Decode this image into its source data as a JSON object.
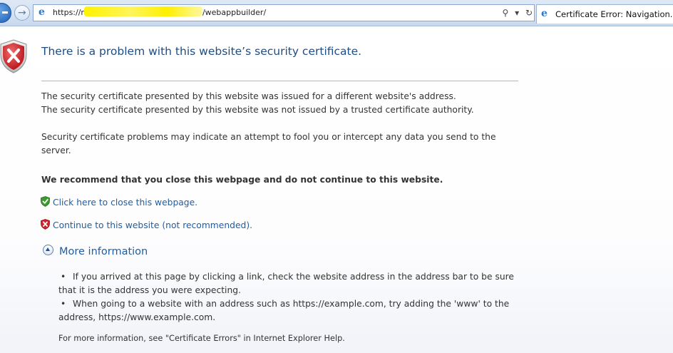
{
  "browser": {
    "url_prefix": "https://r",
    "url_suffix": "/webappbuilder/",
    "tab_title": "Certificate Error: Navigation...",
    "tools": {
      "search_glyph": "⚲",
      "dropdown_glyph": "▾",
      "refresh_glyph": "↻"
    }
  },
  "page": {
    "title": "There is a problem with this website’s security certificate.",
    "reason_1": "The security certificate presented by this website was issued for a different website's address.",
    "reason_2": "The security certificate presented by this website was not issued by a trusted certificate authority.",
    "warning": "Security certificate problems may indicate an attempt to fool you or intercept any data you send to the server.",
    "recommendation": "We recommend that you close this webpage and do not continue to this website.",
    "close_link": "Click here to close this webpage.",
    "continue_link": "Continue to this website (not recommended).",
    "more_info_label": "More information",
    "more_info_items": [
      "If you arrived at this page by clicking a link, check the website address in the address bar to be sure that it is the address you were expecting.",
      "When going to a website with an address such as https://example.com, try adding the 'www' to the address, https://www.example.com."
    ],
    "footer": "For more information, see \"Certificate Errors\" in Internet Explorer Help."
  },
  "icons": {
    "error_shield": "shield-x-icon",
    "ok_shield": "shield-check-icon",
    "bad_shield": "shield-x-small-icon",
    "expand": "chevron-up-icon",
    "ie": "ie-logo-icon"
  },
  "colors": {
    "link": "#1f5ea3",
    "title": "#1e4d86",
    "error_red": "#d2232a",
    "ok_green": "#3c9a2e"
  }
}
